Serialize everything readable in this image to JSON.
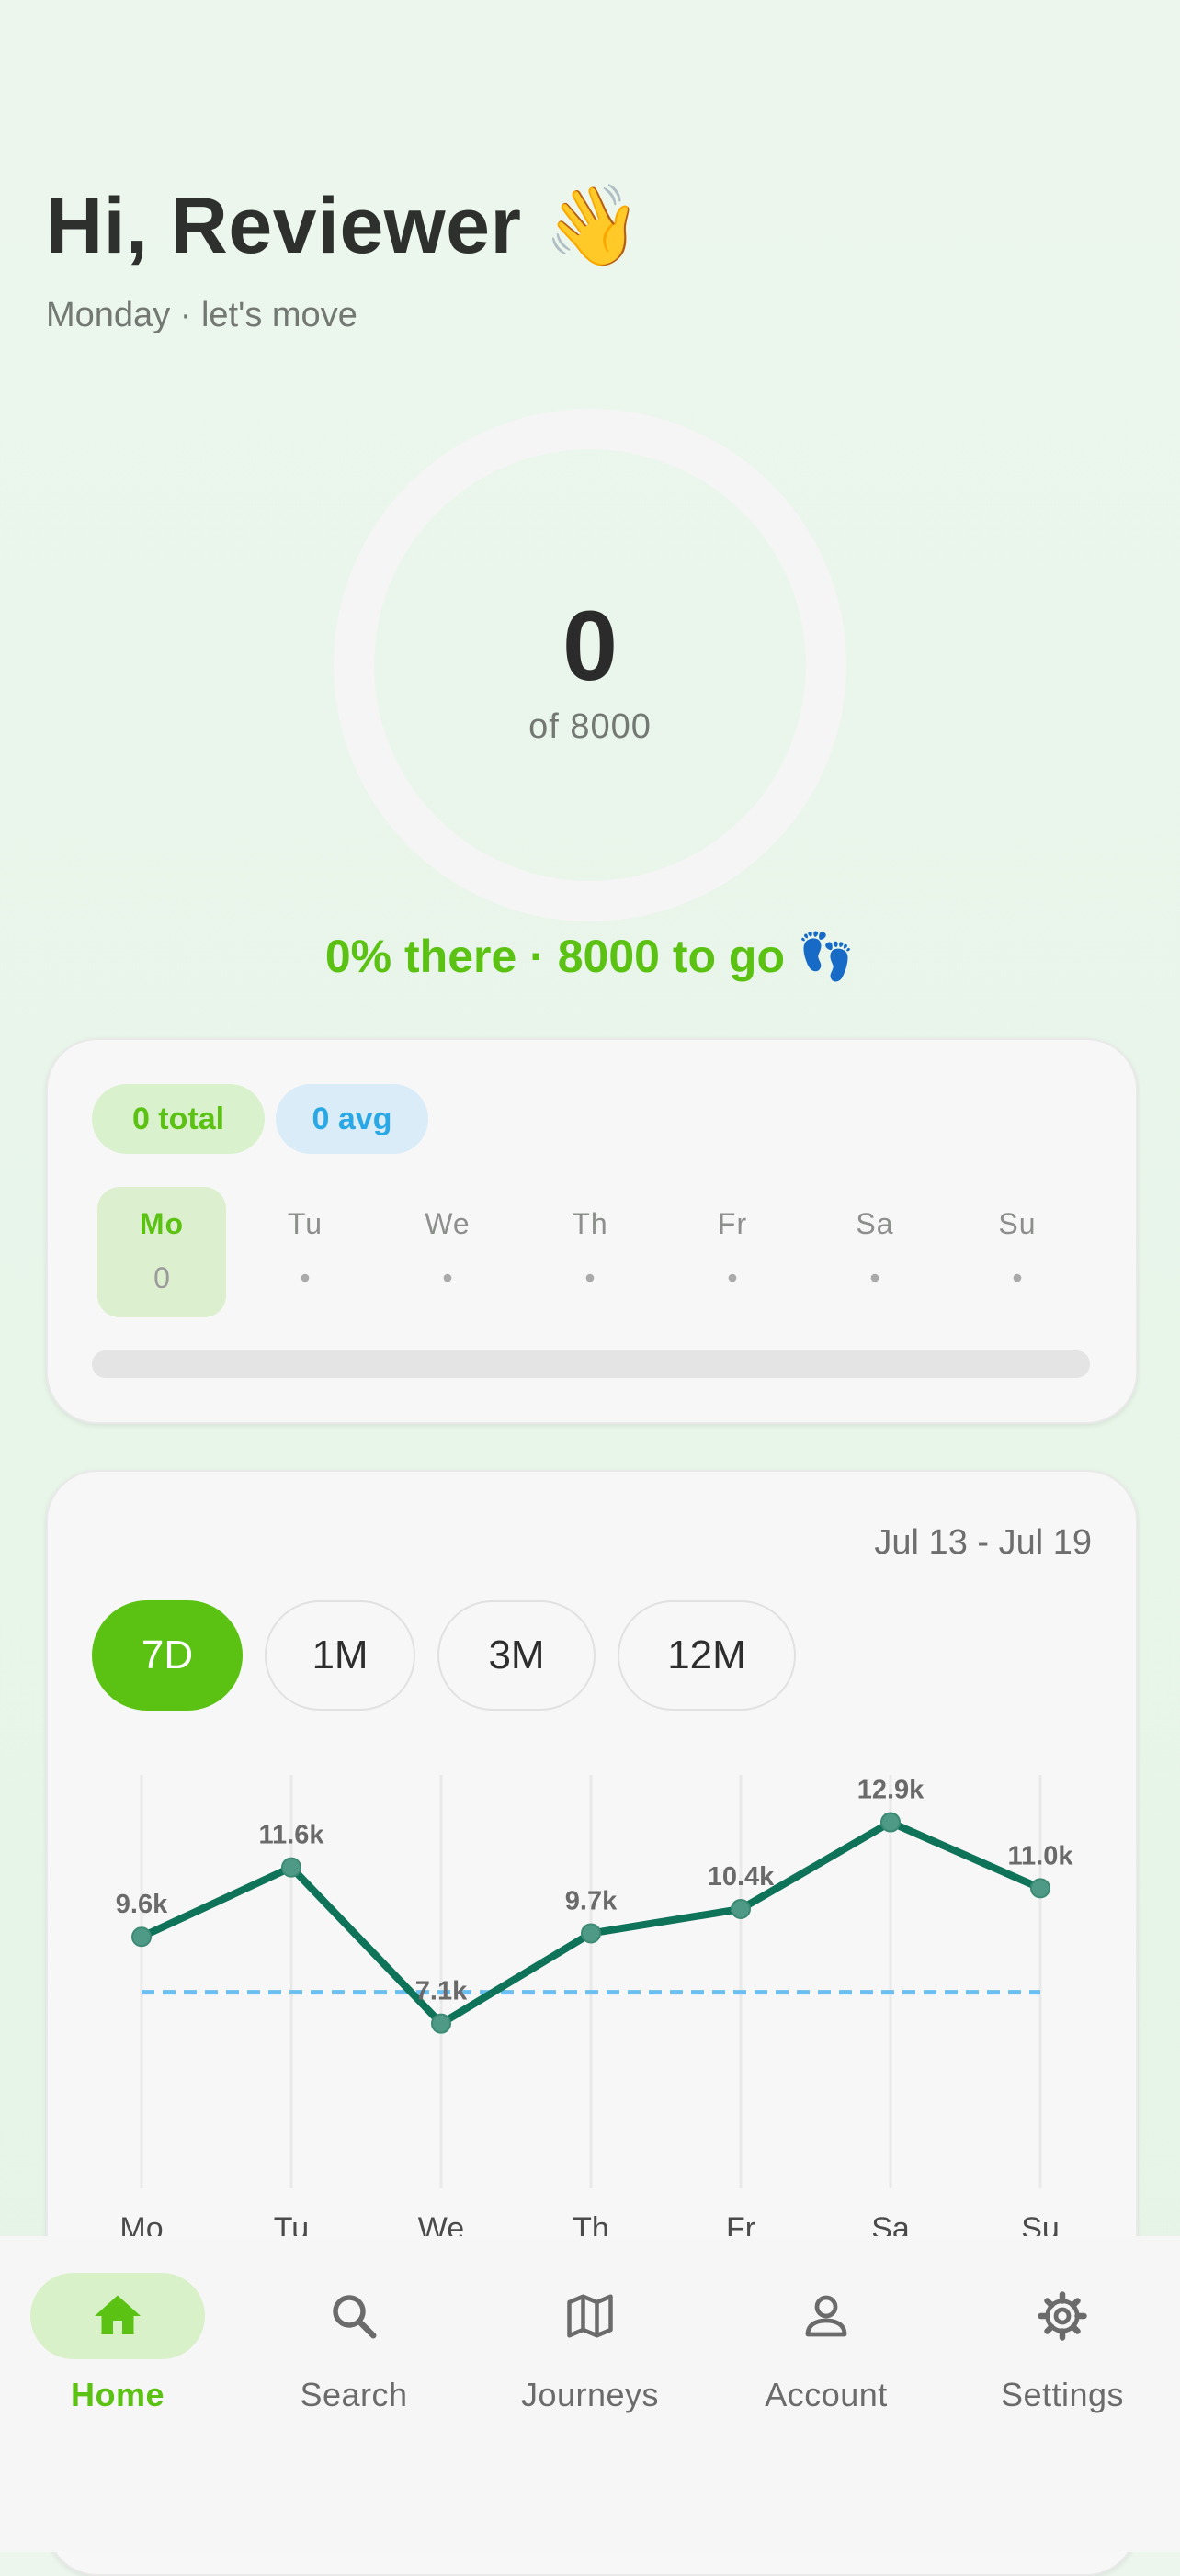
{
  "header": {
    "greeting": "Hi, Reviewer 👋",
    "subtitle": "Monday · let's move"
  },
  "progress": {
    "steps": "0",
    "goal_label": "of 8000",
    "fraction": 0,
    "message": "0% there · 8000 to go 👣"
  },
  "week": {
    "total_label": "0 total",
    "avg_label": "0 avg",
    "days": [
      {
        "name": "Mo",
        "value": "0"
      },
      {
        "name": "Tu",
        "value": "•"
      },
      {
        "name": "We",
        "value": "•"
      },
      {
        "name": "Th",
        "value": "•"
      },
      {
        "name": "Fr",
        "value": "•"
      },
      {
        "name": "Sa",
        "value": "•"
      },
      {
        "name": "Su",
        "value": "•"
      }
    ],
    "progress_fraction": 0
  },
  "history": {
    "date_range": "Jul 13 - Jul 19",
    "ranges": [
      "7D",
      "1M",
      "3M",
      "12M"
    ],
    "selected_range": "7D"
  },
  "chart_data": {
    "type": "line",
    "categories": [
      "Mo",
      "Tu",
      "We",
      "Th",
      "Fr",
      "Sa",
      "Su"
    ],
    "values": [
      9600,
      11600,
      7100,
      9700,
      10400,
      12900,
      11000
    ],
    "value_labels": [
      "9.6k",
      "11.6k",
      "7.1k",
      "9.7k",
      "10.4k",
      "12.9k",
      "11.0k"
    ],
    "goal_line": 8000,
    "ylim": [
      0,
      13000
    ],
    "grid": "vertical",
    "line_color": "#0e7358",
    "goal_color": "#6bbff0"
  },
  "nav": {
    "items": [
      {
        "label": "Home",
        "icon": "home-icon"
      },
      {
        "label": "Search",
        "icon": "search-icon"
      },
      {
        "label": "Journeys",
        "icon": "map-icon"
      },
      {
        "label": "Account",
        "icon": "person-icon"
      },
      {
        "label": "Settings",
        "icon": "gear-icon"
      }
    ],
    "active": "Home"
  },
  "colors": {
    "accent": "#5bc214",
    "secondary": "#2aa8e6"
  }
}
